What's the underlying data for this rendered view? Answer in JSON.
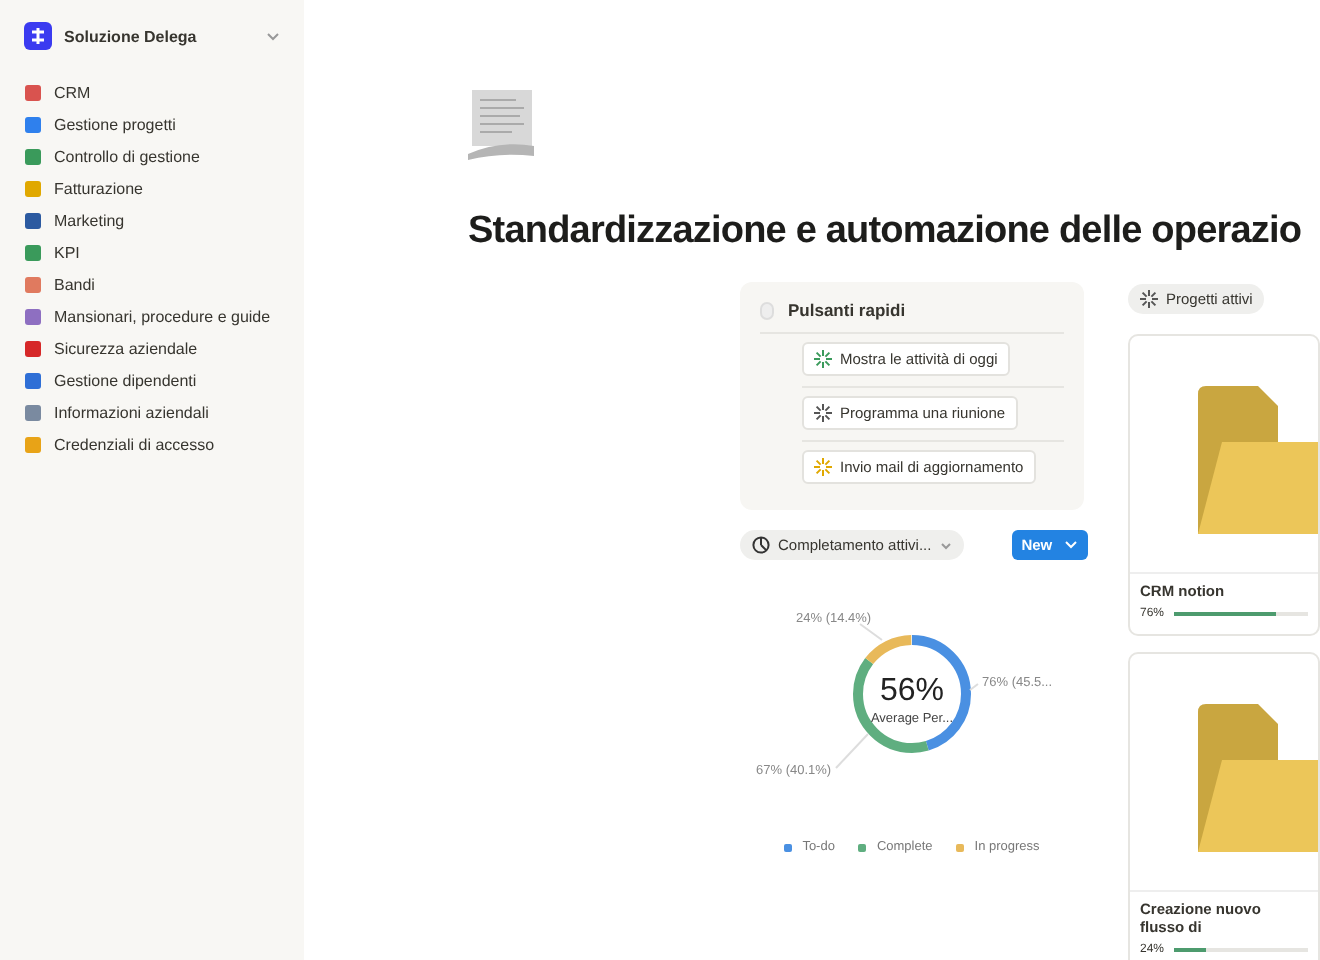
{
  "sidebar": {
    "workspace": "Soluzione Delega",
    "items": [
      {
        "label": "CRM"
      },
      {
        "label": "Gestione progetti"
      },
      {
        "label": "Controllo di gestione"
      },
      {
        "label": "Fatturazione"
      },
      {
        "label": "Marketing"
      },
      {
        "label": "KPI"
      },
      {
        "label": "Bandi"
      },
      {
        "label": "Mansionari, procedure e guide"
      },
      {
        "label": "Sicurezza aziendale"
      },
      {
        "label": "Gestione dipendenti"
      },
      {
        "label": "Informazioni aziendali"
      },
      {
        "label": "Credenziali di accesso"
      }
    ]
  },
  "page": {
    "title": "Standardizzazione e automazione delle operazio"
  },
  "quick_buttons": {
    "title": "Pulsanti rapidi",
    "buttons": [
      "Mostra le attività di oggi",
      "Programma una riunione",
      "Invio mail di aggiornamento"
    ]
  },
  "chart_view": {
    "view": "Completamento attivi...",
    "new_button": "New",
    "center_value": "56%",
    "center_label": "Average Per...",
    "chart_data": {
      "type": "donut",
      "categories": [
        "To-do",
        "Complete",
        "In progress"
      ],
      "values": [
        76,
        67,
        24
      ],
      "colors": [
        "#4a90e2",
        "#5fae80",
        "#e8b95a"
      ],
      "value_labels": [
        "76% (45.5...",
        "67% (40.1%)",
        "24% (14.4%)"
      ],
      "legend": "bottom"
    }
  },
  "projects": {
    "tab": "Progetti attivi",
    "cards": [
      {
        "name": "CRM notion",
        "reading": "76%",
        "level": 0.76
      },
      {
        "name": "Creazione nuovo flusso di",
        "reading": "24%",
        "level": 0.24
      }
    ]
  }
}
